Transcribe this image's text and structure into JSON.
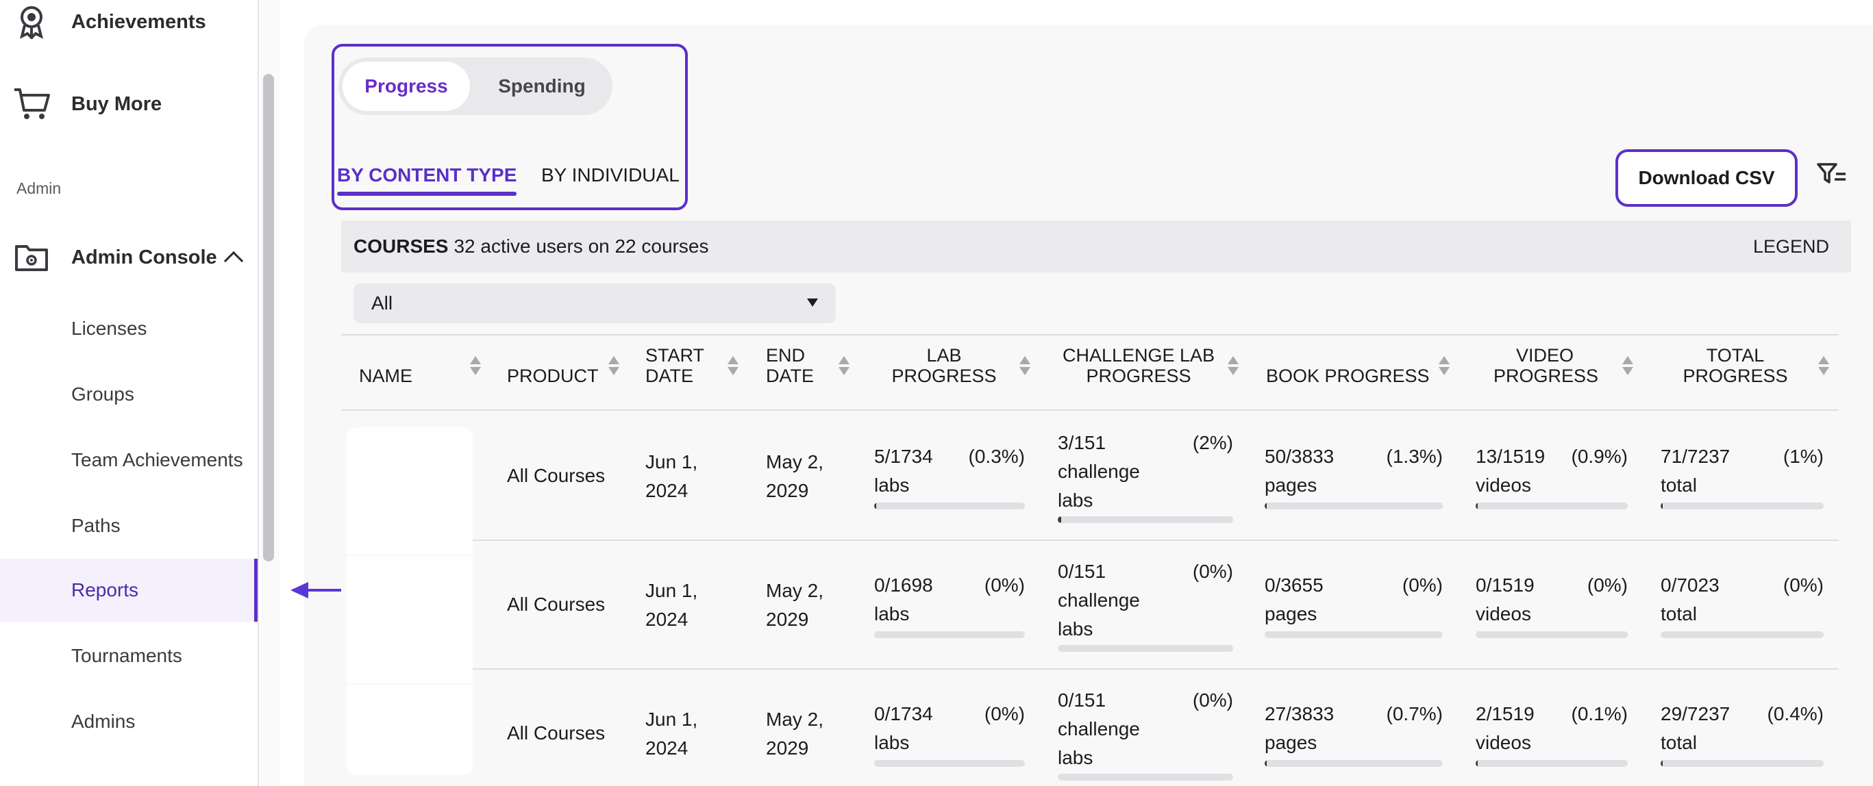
{
  "sidebar": {
    "achievements_label": "Achievements",
    "buy_more_label": "Buy More",
    "section_admin": "Admin",
    "admin_console_label": "Admin Console",
    "sub_items": [
      "Licenses",
      "Groups",
      "Team Achievements",
      "Paths",
      "Reports",
      "Tournaments",
      "Admins"
    ],
    "active_item": "Reports"
  },
  "view_toggle": {
    "progress": "Progress",
    "spending": "Spending",
    "selected": "Progress"
  },
  "sub_tabs": {
    "by_content_type": "BY CONTENT TYPE",
    "by_individual": "BY INDIVIDUAL",
    "selected": "BY CONTENT TYPE"
  },
  "toolbar": {
    "download_csv": "Download CSV",
    "filter_icon": "filter-icon"
  },
  "table": {
    "title_bold": "COURSES",
    "title_rest": "32 active users on 22 courses",
    "legend": "LEGEND",
    "filter_value": "All",
    "columns": {
      "name": "NAME",
      "product": "PRODUCT",
      "start_1": "START",
      "start_2": "DATE",
      "end_1": "END",
      "end_2": "DATE",
      "lab_1": "LAB",
      "lab_2": "PROGRESS",
      "clab_1": "CHALLENGE LAB",
      "clab_2": "PROGRESS",
      "book": "BOOK PROGRESS",
      "video_1": "VIDEO",
      "video_2": "PROGRESS",
      "total_1": "TOTAL",
      "total_2": "PROGRESS"
    },
    "rows": [
      {
        "product": "All Courses",
        "start_1": "Jun 1,",
        "start_2": "2024",
        "end_1": "May 2,",
        "end_2": "2029",
        "lab_frac": "5/1734",
        "lab_pct": "(0.3%)",
        "lab_unit": "labs",
        "lab_fill": 0.003,
        "clab_frac": "3/151",
        "clab_pct": "(2%)",
        "clab_unit_1": "challenge",
        "clab_unit_2": "labs",
        "clab_fill": 0.02,
        "book_frac": "50/3833",
        "book_pct": "(1.3%)",
        "book_unit": "pages",
        "book_fill": 0.013,
        "video_frac": "13/1519",
        "video_pct": "(0.9%)",
        "video_unit": "videos",
        "video_fill": 0.009,
        "total_frac": "71/7237",
        "total_pct": "(1%)",
        "total_unit": "total",
        "total_fill": 0.01
      },
      {
        "product": "All Courses",
        "start_1": "Jun 1,",
        "start_2": "2024",
        "end_1": "May 2,",
        "end_2": "2029",
        "lab_frac": "0/1698",
        "lab_pct": "(0%)",
        "lab_unit": "labs",
        "lab_fill": 0,
        "clab_frac": "0/151",
        "clab_pct": "(0%)",
        "clab_unit_1": "challenge",
        "clab_unit_2": "labs",
        "clab_fill": 0,
        "book_frac": "0/3655",
        "book_pct": "(0%)",
        "book_unit": "pages",
        "book_fill": 0,
        "video_frac": "0/1519",
        "video_pct": "(0%)",
        "video_unit": "videos",
        "video_fill": 0,
        "total_frac": "0/7023",
        "total_pct": "(0%)",
        "total_unit": "total",
        "total_fill": 0
      },
      {
        "product": "All Courses",
        "start_1": "Jun 1,",
        "start_2": "2024",
        "end_1": "May 2,",
        "end_2": "2029",
        "lab_frac": "0/1734",
        "lab_pct": "(0%)",
        "lab_unit": "labs",
        "lab_fill": 0,
        "clab_frac": "0/151",
        "clab_pct": "(0%)",
        "clab_unit_1": "challenge",
        "clab_unit_2": "labs",
        "clab_fill": 0,
        "book_frac": "27/3833",
        "book_pct": "(0.7%)",
        "book_unit": "pages",
        "book_fill": 0.007,
        "video_frac": "2/1519",
        "video_pct": "(0.1%)",
        "video_unit": "videos",
        "video_fill": 0.001,
        "total_frac": "29/7237",
        "total_pct": "(0.4%)",
        "total_unit": "total",
        "total_fill": 0.004
      }
    ]
  },
  "colors": {
    "accent": "#5b30c8",
    "accent_text": "#6a2bc9",
    "active_bg": "#f4f0fc"
  }
}
